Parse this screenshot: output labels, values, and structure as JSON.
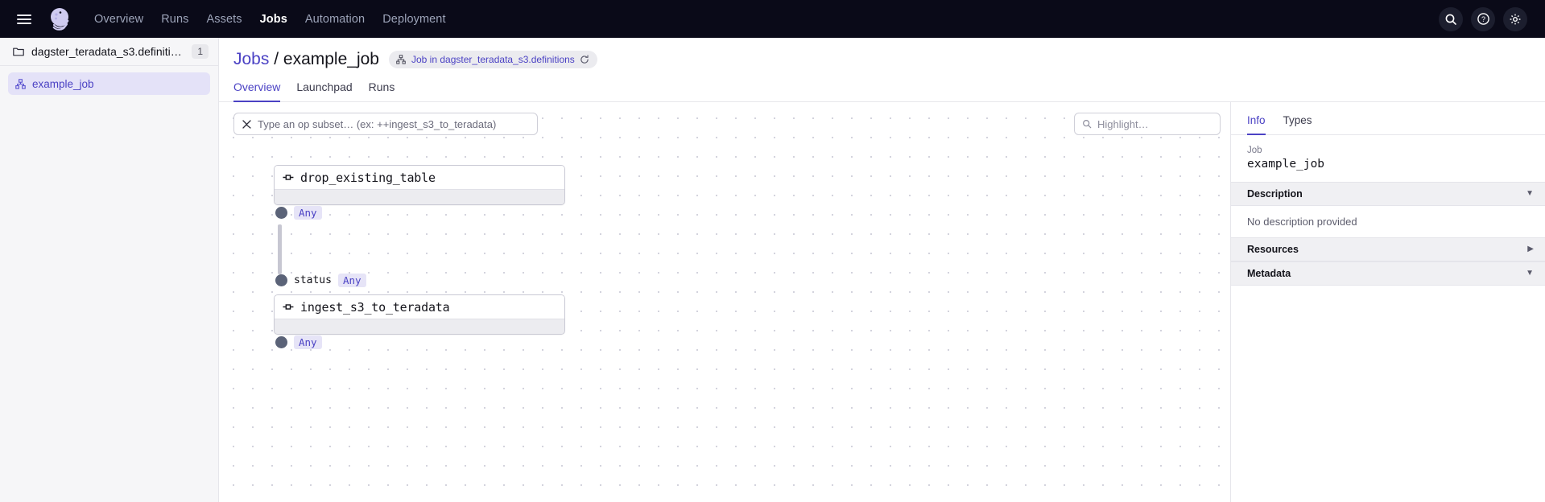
{
  "topnav": {
    "menu_icon": "hamburger-icon",
    "logo_icon": "dagster-logo",
    "links": [
      {
        "label": "Overview",
        "active": false
      },
      {
        "label": "Runs",
        "active": false
      },
      {
        "label": "Assets",
        "active": false
      },
      {
        "label": "Jobs",
        "active": true
      },
      {
        "label": "Automation",
        "active": false
      },
      {
        "label": "Deployment",
        "active": false
      }
    ],
    "icons": [
      {
        "name": "search-icon"
      },
      {
        "name": "help-icon"
      },
      {
        "name": "gear-icon"
      }
    ]
  },
  "sidebar": {
    "repository": {
      "icon": "folder-icon",
      "name": "dagster_teradata_s3.definitions",
      "count": "1"
    },
    "jobs": [
      {
        "icon": "job-icon",
        "label": "example_job",
        "selected": true
      }
    ]
  },
  "header": {
    "breadcrumb_root": "Jobs",
    "breadcrumb_separator": "/",
    "breadcrumb_current": "example_job",
    "pill": {
      "icon": "job-graph-icon",
      "text": "Job in dagster_teradata_s3.definitions",
      "reload_icon": "reload-icon"
    },
    "tabs": [
      {
        "label": "Overview",
        "active": true
      },
      {
        "label": "Launchpad",
        "active": false
      },
      {
        "label": "Runs",
        "active": false
      }
    ]
  },
  "graph": {
    "subset_input": {
      "icon": "op-subset-icon",
      "placeholder": "Type an op subset… (ex: ++ingest_s3_to_teradata)",
      "value": ""
    },
    "highlight_input": {
      "icon": "search-icon",
      "placeholder": "Highlight…",
      "value": ""
    },
    "nodes": [
      {
        "icon": "op-icon",
        "title": "drop_existing_table"
      },
      {
        "icon": "op-icon",
        "title": "ingest_s3_to_teradata"
      }
    ],
    "ports": [
      {
        "name": "",
        "type": "Any"
      },
      {
        "name": "status",
        "type": "Any"
      },
      {
        "name": "",
        "type": "Any"
      }
    ]
  },
  "right_panel": {
    "tabs": [
      {
        "label": "Info",
        "active": true
      },
      {
        "label": "Types",
        "active": false
      }
    ],
    "job_label": "Job",
    "job_name": "example_job",
    "sections": [
      {
        "title": "Description",
        "chevron": "▼",
        "body": "No description provided"
      },
      {
        "title": "Resources",
        "chevron": "▶",
        "body": ""
      },
      {
        "title": "Metadata",
        "chevron": "▼",
        "body": ""
      }
    ]
  },
  "colors": {
    "accent": "#4b42c4",
    "nav_bg": "#0a0a18",
    "sidebar_bg": "#f6f6f8"
  }
}
